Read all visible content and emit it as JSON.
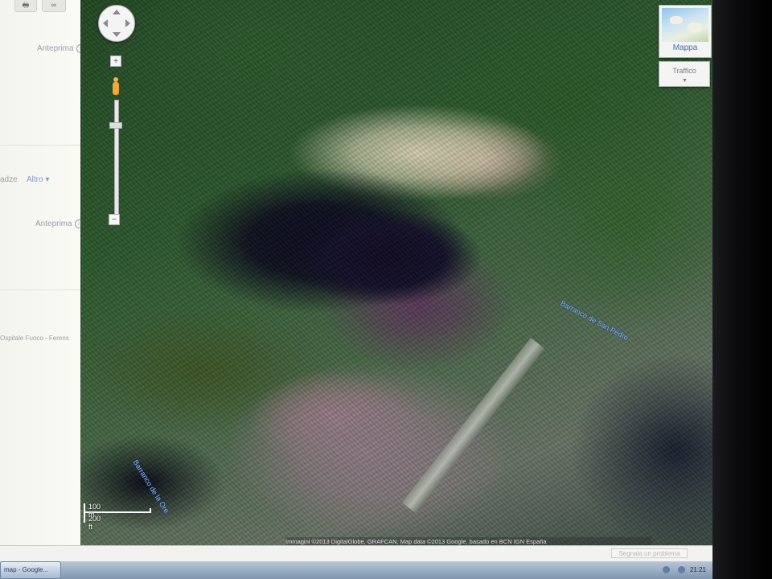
{
  "left_panel": {
    "top_buttons": [
      "🖶",
      "∞"
    ],
    "anteprima_1": "Anteprima",
    "partial_word": "adze",
    "altro_link": "Altro ▾",
    "anteprima_2": "Anteprima",
    "snippet": "Ospitale Fuoco - Ferens"
  },
  "map_controls": {
    "zoom_in": "+",
    "zoom_out": "–",
    "map_type_label": "Mappa",
    "traffic_label": "Traffico"
  },
  "map_labels": {
    "river_1": "Barranco de San Pedro",
    "river_2": "Barranco de la Ore"
  },
  "scale": {
    "top": "100 m",
    "bottom": "200 ft"
  },
  "footer": {
    "attribution": "Immagini ©2013 DigitalGlobe, GRAFCAN, Map data ©2013 Google, basado en BCN IGN España",
    "report_problem": "Segnala un problema"
  },
  "taskbar": {
    "window_label": "map - Google...",
    "clock": "21:21"
  }
}
